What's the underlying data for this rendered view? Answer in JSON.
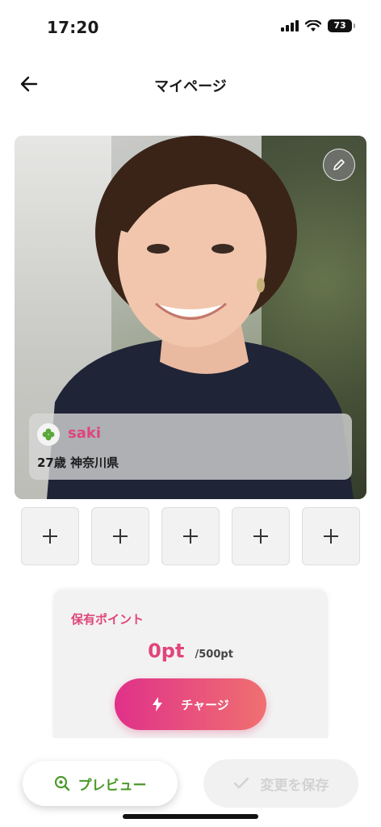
{
  "status_bar": {
    "time": "17:20",
    "battery": "73"
  },
  "header": {
    "title": "マイページ"
  },
  "profile": {
    "name": "saki",
    "meta": "27歳  神奈川県"
  },
  "photo_slots": [
    "+",
    "+",
    "+",
    "+",
    "+"
  ],
  "points": {
    "label": "保有ポイント",
    "value": "0pt",
    "max": "/500pt",
    "charge_label": "チャージ"
  },
  "bottom": {
    "preview_label": "プレビュー",
    "save_label": "変更を保存"
  },
  "colors": {
    "accent_pink": "#e0457b",
    "preview_green": "#4a9a2a",
    "charge_start": "#e0318a",
    "charge_end": "#f07070"
  }
}
